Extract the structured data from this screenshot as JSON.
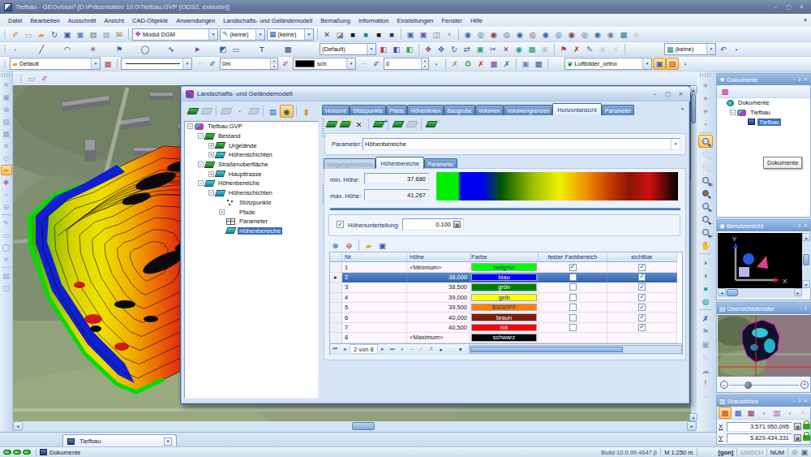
{
  "window": {
    "title": "Tiefbau - GEOvision³  [D:\\Präsentation 10.0\\Tiefbau.GVP (ODS2, exklusiv)]"
  },
  "menubar": {
    "items": [
      "Datei",
      "Bearbeiten",
      "Ausschnitt",
      "Ansicht",
      "CAD-Objekte",
      "Anwendungen",
      "Landschafts- und Geländemodell",
      "Bemaßung",
      "Information",
      "Einstellungen",
      "Fenster",
      "Hilfe"
    ]
  },
  "toolbars": {
    "combo_modul": "Modul DGM",
    "combo_keine1": "(keine)",
    "combo_keine2": "(keine)",
    "combo_default2": "(Default)",
    "combo_keine3": "(keine)",
    "combo_default3": "Default",
    "combo_0m": "0m",
    "combo_sch": "sch",
    "combo_0": "0",
    "combo_luftbilder": "Luftbilder_ortho"
  },
  "dialog": {
    "title": "Landschafts- und Geländemodell",
    "tabs": [
      "Horizont",
      "Stützpunkte",
      "Pfade",
      "Höhenlinien",
      "Baugrube",
      "Volumen",
      "Volumengrenzen",
      "Horizontansicht",
      "Parameter"
    ],
    "active_tab": "Horizontansicht",
    "tree": [
      {
        "label": "Tiefbau.GVP",
        "depth": 0,
        "exp": "-",
        "icon": "gvp"
      },
      {
        "label": "Bestand",
        "depth": 1,
        "exp": "-",
        "icon": "surf"
      },
      {
        "label": "Urgelände",
        "depth": 2,
        "exp": "+",
        "icon": "surf"
      },
      {
        "label": "Höhenschichten",
        "depth": 2,
        "exp": "+",
        "icon": "lay"
      },
      {
        "label": "Straßenoberfläche",
        "depth": 1,
        "exp": "-",
        "icon": "surf"
      },
      {
        "label": "Haupttrasse",
        "depth": 2,
        "exp": "+",
        "icon": "lay"
      },
      {
        "label": "Höhenbereiche",
        "depth": 1,
        "exp": "-",
        "icon": "lay"
      },
      {
        "label": "Höhenschichten",
        "depth": 2,
        "exp": "-",
        "icon": "lay"
      },
      {
        "label": "Stützpunkte",
        "depth": 3,
        "exp": null,
        "icon": "pts"
      },
      {
        "label": "Pfade",
        "depth": 3,
        "exp": "+",
        "icon": "path"
      },
      {
        "label": "Parameter",
        "depth": 3,
        "exp": null,
        "icon": "tbl"
      },
      {
        "label": "Höhenbereiche",
        "depth": 3,
        "exp": null,
        "icon": "lay",
        "selected": true
      }
    ],
    "parameter_label": "Parameter:",
    "parameter_value": "Höhenbereiche",
    "subtabs": [
      {
        "label": "Neigungsbereiche",
        "state": "disabled"
      },
      {
        "label": "Höhenbereiche",
        "state": "active"
      },
      {
        "label": "Parameter",
        "state": "normal"
      }
    ],
    "min_label": "min. Höhe:",
    "min_value": "37,680",
    "max_label": "max. Höhe:",
    "max_value": "41,267",
    "unterteilung_label": "Höhenunterteilung:",
    "unterteilung_value": "0,100",
    "unterteilung_checked": true,
    "gradient_stops": [
      {
        "pos": 0,
        "color": "#00ee00"
      },
      {
        "pos": 9,
        "color": "#00ee00"
      },
      {
        "pos": 10,
        "color": "#0000f0"
      },
      {
        "pos": 19,
        "color": "#0000f0"
      },
      {
        "pos": 27,
        "color": "#005800"
      },
      {
        "pos": 40,
        "color": "#9cc000"
      },
      {
        "pos": 51,
        "color": "#f0f000"
      },
      {
        "pos": 62,
        "color": "#f09000"
      },
      {
        "pos": 72,
        "color": "#c83800"
      },
      {
        "pos": 80,
        "color": "#8a1408"
      },
      {
        "pos": 88,
        "color": "#d01010"
      },
      {
        "pos": 100,
        "color": "#000000"
      }
    ],
    "table": {
      "columns": [
        "Nr.",
        "Höhe",
        "Farbe",
        "fester Farbbereich",
        "sichtbar"
      ],
      "rows": [
        {
          "nr": "1",
          "hoehe": "<Minimum>",
          "farbe": "hellgrün",
          "color": "#00ff00",
          "tcolor": "#0a3a7a",
          "fester": true,
          "sichtbar": true,
          "selected": false
        },
        {
          "nr": "2",
          "hoehe": "38,000",
          "farbe": "blau",
          "color": "#0000ff",
          "tcolor": "#ffffff",
          "fester": false,
          "sichtbar": true,
          "selected": true
        },
        {
          "nr": "3",
          "hoehe": "38,500",
          "farbe": "grün",
          "color": "#008000",
          "tcolor": "#ffffff",
          "fester": false,
          "sichtbar": true,
          "selected": false
        },
        {
          "nr": "4",
          "hoehe": "39,000",
          "farbe": "gelb",
          "color": "#ffff00",
          "tcolor": "#0a3a7a",
          "fester": false,
          "sichtbar": true,
          "selected": false
        },
        {
          "nr": "5",
          "hoehe": "39,500",
          "farbe": "$0080FF",
          "color": "#ff8000",
          "tcolor": "#0a3a7a",
          "fester": false,
          "sichtbar": true,
          "selected": false
        },
        {
          "nr": "6",
          "hoehe": "40,000",
          "farbe": "braun",
          "color": "#7b1e10",
          "tcolor": "#ffffff",
          "fester": false,
          "sichtbar": true,
          "selected": false
        },
        {
          "nr": "7",
          "hoehe": "40,500",
          "farbe": "rot",
          "color": "#ff0000",
          "tcolor": "#ffffff",
          "fester": false,
          "sichtbar": true,
          "selected": false
        },
        {
          "nr": "8",
          "hoehe": "<Maximum>",
          "farbe": "schwarz",
          "color": "#000000",
          "tcolor": "#ffffff",
          "fester": null,
          "sichtbar": null,
          "selected": false
        }
      ],
      "navigator": "2 von 8"
    }
  },
  "panels": {
    "dokumente": {
      "title": "Dokumente",
      "tree": [
        {
          "label": "Dokumente",
          "depth": 0,
          "exp": null,
          "icon": "globe"
        },
        {
          "label": "Tiefbau",
          "depth": 1,
          "exp": "-",
          "icon": "gvp"
        },
        {
          "label": "Tiefbau",
          "depth": 2,
          "exp": null,
          "icon": "docw",
          "selected": true
        }
      ],
      "tooltip": "Dokumente"
    },
    "benutzersicht": {
      "title": "Benutzersicht",
      "axis_x": "X",
      "axis_y": "Y"
    },
    "uebersicht": {
      "title": "Übersichtsfenster"
    },
    "statusblock": {
      "title": "Statusblock",
      "x_label": "X",
      "x_value": "3.571.950,095",
      "y_label": "Y",
      "y_value": "5.829.434,331"
    }
  },
  "doc_tab": {
    "label": "Tiefbau"
  },
  "statusbar": {
    "left": "Dokumente",
    "build": "Build 10.0.99.4647 β",
    "scale": "M 1:250 m",
    "angle_unit": "[gon]",
    "umsch": "UMSCH",
    "num": "NUM"
  }
}
